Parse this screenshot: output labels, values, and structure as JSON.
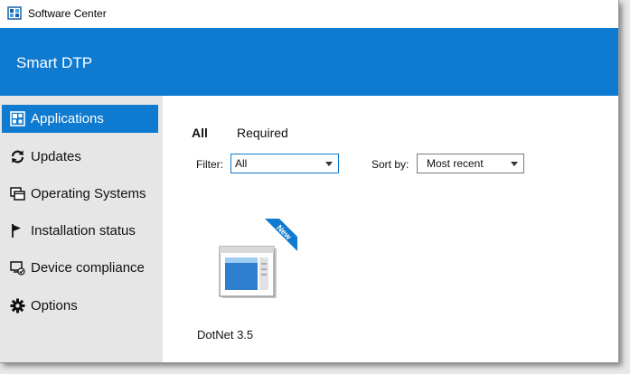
{
  "window": {
    "title": "Software Center"
  },
  "header": {
    "title": "Smart DTP"
  },
  "sidebar": {
    "items": [
      {
        "label": "Applications",
        "icon": "applications-grid-icon",
        "active": true
      },
      {
        "label": "Updates",
        "icon": "refresh-icon",
        "active": false
      },
      {
        "label": "Operating Systems",
        "icon": "windows-stack-icon",
        "active": false
      },
      {
        "label": "Installation status",
        "icon": "flag-icon",
        "active": false
      },
      {
        "label": "Device compliance",
        "icon": "device-check-icon",
        "active": false
      },
      {
        "label": "Options",
        "icon": "gear-icon",
        "active": false
      }
    ]
  },
  "main": {
    "tabs": [
      {
        "label": "All",
        "active": true
      },
      {
        "label": "Required",
        "active": false
      }
    ],
    "filter": {
      "label": "Filter:",
      "value": "All"
    },
    "sort": {
      "label": "Sort by:",
      "value": "Most recent"
    },
    "apps": [
      {
        "name": "DotNet 3.5",
        "badge": "New"
      }
    ]
  },
  "colors": {
    "accent": "#0e7ad0",
    "sidebar_bg": "#e6e6e6"
  }
}
